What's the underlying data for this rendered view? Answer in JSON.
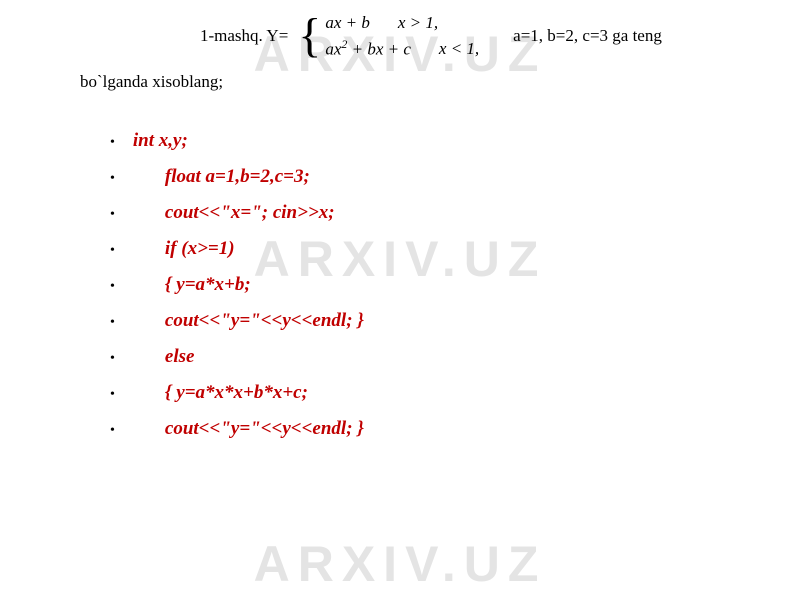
{
  "watermark": "ARXIV.UZ",
  "problem": {
    "prefix": "1-mashq. Y=",
    "piece1_left": "ax + b",
    "piece1_right": "x > 1,",
    "piece2_left": "ax² + bx + c",
    "piece2_right": "x < 1,",
    "suffix": "a=1, b=2, c=3 ga teng",
    "line2": "bo`lganda xisoblang;"
  },
  "code": {
    "lines": [
      {
        "text": "int x,y;",
        "indent": false
      },
      {
        "text": "float a=1,b=2,c=3;",
        "indent": true
      },
      {
        "text": "cout<<\"x=\"; cin>>x;",
        "indent": true
      },
      {
        "text": "if (x>=1)",
        "indent": true
      },
      {
        "text": "{     y=a*x+b;",
        "indent": true
      },
      {
        "text": "cout<<\"y=\"<<y<<endl;    }",
        "indent": true
      },
      {
        "text": "else",
        "indent": true
      },
      {
        "text": "{  y=a*x*x+b*x+c;",
        "indent": true
      },
      {
        "text": "cout<<\"y=\"<<y<<endl;       }",
        "indent": true
      }
    ]
  }
}
